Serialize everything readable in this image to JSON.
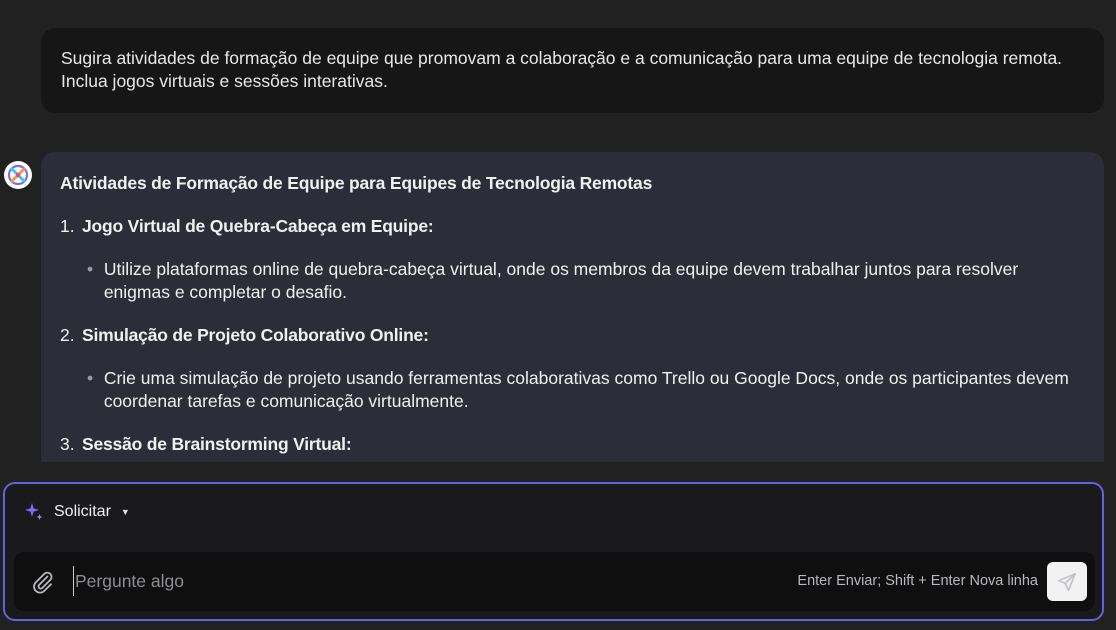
{
  "user_message": "Sugira atividades de formação de equipe que promovam a colaboração e a comunicação para uma equipe de tecnologia remota. Inclua jogos virtuais e sessões interativas.",
  "assistant": {
    "title": "Atividades de Formação de Equipe para Equipes de Tecnologia Remotas",
    "items": [
      {
        "number": "1.",
        "label": "Jogo Virtual de Quebra-Cabeça em Equipe:",
        "bullet": "Utilize plataformas online de quebra-cabeça virtual, onde os membros da equipe devem trabalhar juntos para resolver enigmas e completar o desafio."
      },
      {
        "number": "2.",
        "label": "Simulação de Projeto Colaborativo Online:",
        "bullet": "Crie uma simulação de projeto usando ferramentas colaborativas como Trello ou Google Docs, onde os participantes devem coordenar tarefas e comunicação virtualmente."
      },
      {
        "number": "3.",
        "label": "Sessão de Brainstorming Virtual:"
      }
    ],
    "bullet_glyph": "•"
  },
  "composer": {
    "mode_label": "Solicitar",
    "placeholder": "Pergunte algo",
    "hint": "Enter Enviar; Shift + Enter Nova linha"
  },
  "colors": {
    "background": "#212121",
    "user_bubble": "#161616",
    "assistant_bubble": "#2d2d3a",
    "composer_border": "#6a5fdc",
    "sparkle": "#7b6cf6"
  },
  "icons": {
    "avatar": "bot-logo-icon",
    "mode": "sparkle-icon",
    "dropdown": "caret-down-icon",
    "attach": "paperclip-icon",
    "send": "send-icon"
  }
}
